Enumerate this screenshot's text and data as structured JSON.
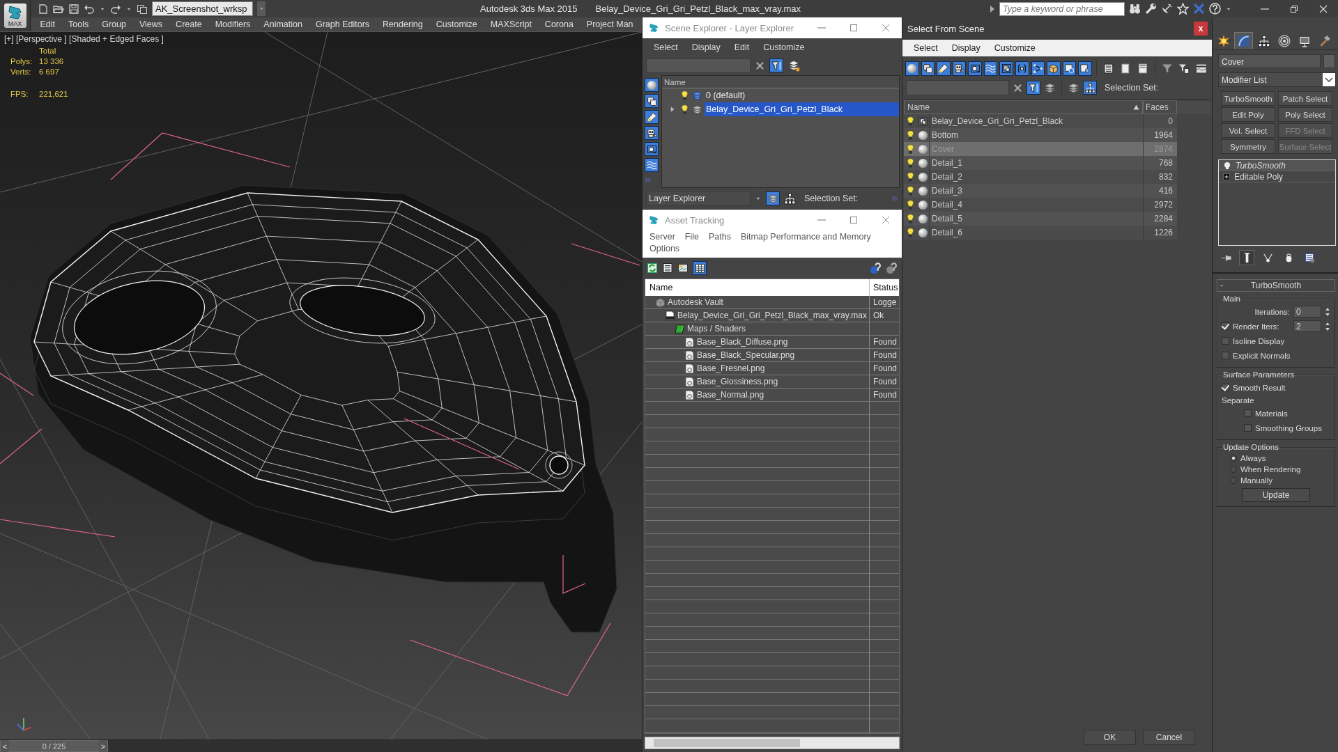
{
  "logo": {
    "label": "MAX"
  },
  "title_bar": {
    "workspace": "AK_Screenshot_wrksp",
    "app_name": "Autodesk 3ds Max  2015",
    "file_name": "Belay_Device_Gri_Gri_Petzl_Black_max_vray.max",
    "search": {
      "placeholder": "Type a keyword or phrase"
    }
  },
  "menu": [
    "Edit",
    "Tools",
    "Group",
    "Views",
    "Create",
    "Modifiers",
    "Animation",
    "Graph Editors",
    "Rendering",
    "Customize",
    "MAXScript",
    "Corona",
    "Project Man"
  ],
  "viewport": {
    "label": "[+] [Perspective ] [Shaded + Edged Faces ]",
    "stats_header": "Total",
    "stats": [
      {
        "label": "Polys:",
        "value": "13 336"
      },
      {
        "label": "Verts:",
        "value": "6 697"
      }
    ],
    "fps": {
      "label": "FPS:",
      "value": "221,621"
    }
  },
  "time_slider": {
    "prev": "<",
    "frame": "0 / 225",
    "next": ">",
    "level": 0
  },
  "scene_explorer": {
    "title": "Scene Explorer - Layer Explorer",
    "menu": [
      "Select",
      "Display",
      "Edit",
      "Customize"
    ],
    "side_tools": [
      {
        "kind": "sphere",
        "on": true
      },
      {
        "kind": "shapes",
        "on": true
      },
      {
        "kind": "lamp",
        "on": true
      },
      {
        "kind": "camera",
        "on": true
      },
      {
        "kind": "tape",
        "on": true
      },
      {
        "kind": "waves",
        "on": true
      }
    ],
    "column": "Name",
    "layers": [
      {
        "name": "0 (default)",
        "selected": false,
        "expandable": false,
        "current": true
      },
      {
        "name": "Belay_Device_Gri_Gri_Petzl_Black",
        "selected": true,
        "expandable": true,
        "current": false
      }
    ],
    "mode": "Layer Explorer",
    "selection_set": "Selection Set:"
  },
  "asset_tracking": {
    "title": "Asset Tracking",
    "menu": [
      "Server",
      "File",
      "Paths",
      "Bitmap Performance and Memory",
      "Options"
    ],
    "columns": [
      "Name",
      "Status"
    ],
    "items": [
      {
        "kind": "vault",
        "name": "Autodesk Vault",
        "status": "Logge",
        "children": [
          {
            "kind": "max",
            "name": "Belay_Device_Gri_Gri_Petzl_Black_max_vray.max",
            "status": "Ok",
            "children": [
              {
                "kind": "maps",
                "name": "Maps / Shaders",
                "children": [
                  {
                    "kind": "bitmap",
                    "name": "Base_Black_Diffuse.png",
                    "status": "Found"
                  },
                  {
                    "kind": "bitmap",
                    "name": "Base_Black_Specular.png",
                    "status": "Found"
                  },
                  {
                    "kind": "bitmap",
                    "name": "Base_Fresnel.png",
                    "status": "Found"
                  },
                  {
                    "kind": "bitmap",
                    "name": "Base_Glossiness.png",
                    "status": "Found"
                  },
                  {
                    "kind": "bitmap",
                    "name": "Base_Normal.png",
                    "status": "Found"
                  }
                ]
              }
            ]
          }
        ]
      }
    ]
  },
  "select_from_scene": {
    "title": "Select From Scene",
    "close": "x",
    "menu": [
      "Select",
      "Display",
      "Customize"
    ],
    "filters": [
      {
        "kind": "sphere",
        "on": true
      },
      {
        "kind": "shapes",
        "on": true
      },
      {
        "kind": "lamp",
        "on": true
      },
      {
        "kind": "camera",
        "on": true
      },
      {
        "kind": "tape",
        "on": true
      },
      {
        "kind": "waves",
        "on": true
      },
      {
        "kind": "group",
        "on": true
      },
      {
        "kind": "brackets",
        "on": true
      },
      {
        "kind": "bone",
        "on": true
      },
      {
        "kind": "box",
        "on": true
      },
      {
        "kind": "xref",
        "on": true
      },
      {
        "kind": "container",
        "on": true
      }
    ],
    "selection_set": "Selection Set:",
    "columns": [
      "Name",
      "Faces"
    ],
    "rows": [
      {
        "kind": "group",
        "name": "Belay_Device_Gri_Gri_Petzl_Black",
        "faces": "0",
        "selected": false
      },
      {
        "kind": "object",
        "name": "Bottom",
        "faces": "1964",
        "selected": false
      },
      {
        "kind": "object",
        "name": "Cover",
        "faces": "2874",
        "selected": true
      },
      {
        "kind": "object",
        "name": "Detail_1",
        "faces": "768",
        "selected": false
      },
      {
        "kind": "object",
        "name": "Detail_2",
        "faces": "832",
        "selected": false
      },
      {
        "kind": "object",
        "name": "Detail_3",
        "faces": "416",
        "selected": false
      },
      {
        "kind": "object",
        "name": "Detail_4",
        "faces": "2972",
        "selected": false
      },
      {
        "kind": "object",
        "name": "Detail_5",
        "faces": "2284",
        "selected": false
      },
      {
        "kind": "object",
        "name": "Detail_6",
        "faces": "1226",
        "selected": false
      }
    ],
    "buttons": [
      "OK",
      "Cancel"
    ]
  },
  "command_panel": {
    "tabs": [
      {
        "kind": "create",
        "selected": false
      },
      {
        "kind": "modify",
        "selected": true
      },
      {
        "kind": "hierarchy",
        "selected": false
      },
      {
        "kind": "motion",
        "selected": false
      },
      {
        "kind": "display",
        "selected": false
      },
      {
        "kind": "utilities",
        "selected": false
      }
    ],
    "object_name": "Cover",
    "modifier_list": "Modifier List",
    "modifiers": [
      {
        "label": "TurboSmooth",
        "disabled": false
      },
      {
        "label": "Patch Select",
        "disabled": false
      },
      {
        "label": "Edit Poly",
        "disabled": false
      },
      {
        "label": "Poly Select",
        "disabled": false
      },
      {
        "label": "Vol. Select",
        "disabled": false
      },
      {
        "label": "FFD Select",
        "disabled": true
      },
      {
        "label": "Symmetry",
        "disabled": false
      },
      {
        "label": "Surface Select",
        "disabled": true
      }
    ],
    "stack": [
      {
        "kind": "modifier",
        "name": "TurboSmooth"
      },
      {
        "kind": "base",
        "name": "Editable Poly"
      }
    ],
    "stack_tools": [
      {
        "kind": "pin",
        "on": false
      },
      {
        "kind": "bar",
        "on": true
      },
      {
        "kind": "branch",
        "on": false
      },
      {
        "kind": "cylinder",
        "on": false
      },
      {
        "kind": "config",
        "on": false
      }
    ],
    "rollout": {
      "collapse": "-",
      "title": "TurboSmooth",
      "groups": [
        {
          "title": "Main",
          "controls": [
            {
              "kind": "spinner",
              "label": "Iterations:",
              "value": "0"
            },
            {
              "kind": "check_spinner",
              "label": "Render Iters:",
              "checked": true,
              "value": "2"
            },
            {
              "kind": "checkbox",
              "label": "Isoline Display",
              "checked": false
            },
            {
              "kind": "checkbox",
              "label": "Explicit Normals",
              "checked": false
            }
          ]
        },
        {
          "title": "Surface Parameters",
          "controls": [
            {
              "kind": "checkbox",
              "label": "Smooth Result",
              "checked": true
            },
            {
              "kind": "label",
              "label": "Separate"
            },
            {
              "kind": "sub_checkbox",
              "label": "Materials",
              "checked": false
            },
            {
              "kind": "sub_checkbox",
              "label": "Smoothing Groups",
              "checked": false
            }
          ]
        },
        {
          "title": "Update Options",
          "controls": [
            {
              "kind": "radio",
              "label": "Always",
              "selected": true
            },
            {
              "kind": "radio",
              "label": "When Rendering",
              "selected": false
            },
            {
              "kind": "radio",
              "label": "Manually",
              "selected": false
            },
            {
              "kind": "button",
              "label": "Update"
            }
          ]
        }
      ]
    }
  }
}
